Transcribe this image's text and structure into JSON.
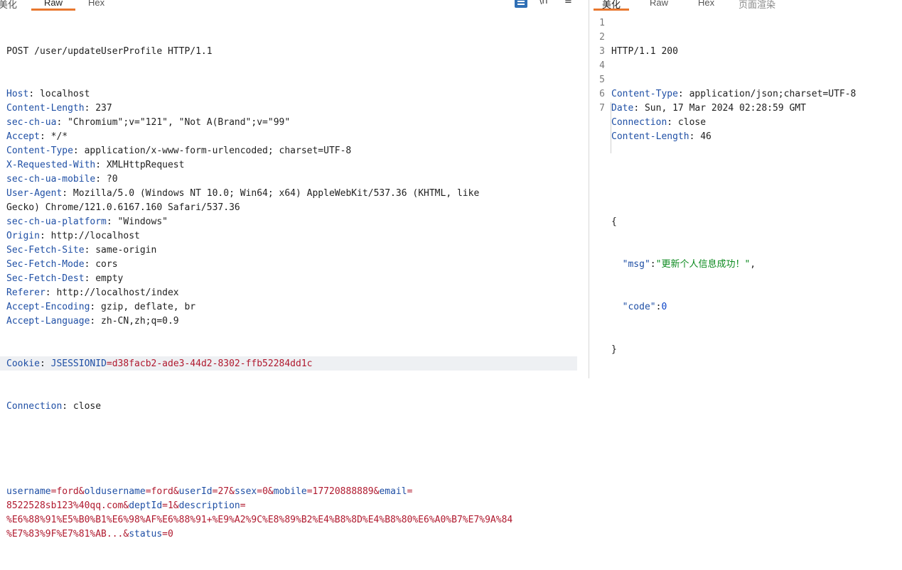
{
  "request": {
    "tabs": [
      "美化",
      "Raw",
      "Hex"
    ],
    "active_tab": "Raw",
    "toolbar": {
      "newline_label": "\\n",
      "menu_label": "≡"
    },
    "request_line": "POST /user/updateUserProfile HTTP/1.1",
    "headers": [
      {
        "name": "Host",
        "value": " localhost"
      },
      {
        "name": "Content-Length",
        "value": " 237"
      },
      {
        "name": "sec-ch-ua",
        "value": " \"Chromium\";v=\"121\", \"Not A(Brand\";v=\"99\""
      },
      {
        "name": "Accept",
        "value": " */*"
      },
      {
        "name": "Content-Type",
        "value": " application/x-www-form-urlencoded; charset=UTF-8"
      },
      {
        "name": "X-Requested-With",
        "value": " XMLHttpRequest"
      },
      {
        "name": "sec-ch-ua-mobile",
        "value": " ?0"
      },
      {
        "name": "User-Agent",
        "value": " Mozilla/5.0 (Windows NT 10.0; Win64; x64) AppleWebKit/537.36 (KHTML, like"
      },
      {
        "name": "",
        "value": "Gecko) Chrome/121.0.6167.160 Safari/537.36"
      },
      {
        "name": "sec-ch-ua-platform",
        "value": " \"Windows\""
      },
      {
        "name": "Origin",
        "value": " http://localhost"
      },
      {
        "name": "Sec-Fetch-Site",
        "value": " same-origin"
      },
      {
        "name": "Sec-Fetch-Mode",
        "value": " cors"
      },
      {
        "name": "Sec-Fetch-Dest",
        "value": " empty"
      },
      {
        "name": "Referer",
        "value": " http://localhost/index"
      },
      {
        "name": "Accept-Encoding",
        "value": " gzip, deflate, br"
      },
      {
        "name": "Accept-Language",
        "value": " zh-CN,zh;q=0.9"
      }
    ],
    "cookie": {
      "name": "Cookie",
      "cookie_key": "JSESSIONID",
      "cookie_value": "=d38facb2-ade3-44d2-8302-ffb52284dd1c"
    },
    "connection": {
      "name": "Connection",
      "value": " close"
    },
    "body_lines": [
      [
        [
          "k",
          "username"
        ],
        [
          "r",
          "=ford&"
        ],
        [
          "k",
          "oldusername"
        ],
        [
          "r",
          "=ford&"
        ],
        [
          "k",
          "userId"
        ],
        [
          "r",
          "=27&"
        ],
        [
          "k",
          "ssex"
        ],
        [
          "r",
          "=0&"
        ],
        [
          "k",
          "mobile"
        ],
        [
          "r",
          "=17720888889&"
        ],
        [
          "k",
          "email"
        ],
        [
          "r",
          "="
        ]
      ],
      [
        [
          "r",
          "8522528sb123%40qq.com&"
        ],
        [
          "k",
          "deptId"
        ],
        [
          "r",
          "=1&"
        ],
        [
          "k",
          "description"
        ],
        [
          "r",
          "="
        ]
      ],
      [
        [
          "r",
          "%E6%88%91%E5%B0%B1%E6%98%AF%E6%88%91+%E9%A2%9C%E8%89%B2%E4%B8%8D%E4%B8%80%E6%A0%B7%E7%9A%84"
        ]
      ],
      [
        [
          "r",
          "%E7%83%9F%E7%81%AB...&"
        ],
        [
          "k",
          "status"
        ],
        [
          "r",
          "=0"
        ]
      ]
    ]
  },
  "response": {
    "tabs": [
      "美化",
      "Raw",
      "Hex",
      "页面渲染"
    ],
    "active_tab": "美化",
    "line_numbers": [
      "1",
      "2",
      "3",
      "4",
      "5",
      "6",
      "7"
    ],
    "status_line": "HTTP/1.1 200",
    "headers": [
      {
        "name": "Content-Type",
        "value": " application/json;charset=UTF-8"
      },
      {
        "name": "Date",
        "value": " Sun, 17 Mar 2024 02:28:59 GMT"
      },
      {
        "name": "Connection",
        "value": " close"
      },
      {
        "name": "Content-Length",
        "value": " 46"
      }
    ],
    "json_open": "{",
    "json_msg_key": "\"msg\"",
    "json_msg_val": "\"更新个人信息成功！\"",
    "json_code_key": "\"code\"",
    "json_code_val": "0",
    "json_close": "}"
  },
  "colors": {
    "accent": "#e8772e",
    "header_key": "#1f4fa5",
    "param_value": "#b0192e",
    "json_string": "#0b8a1e"
  }
}
